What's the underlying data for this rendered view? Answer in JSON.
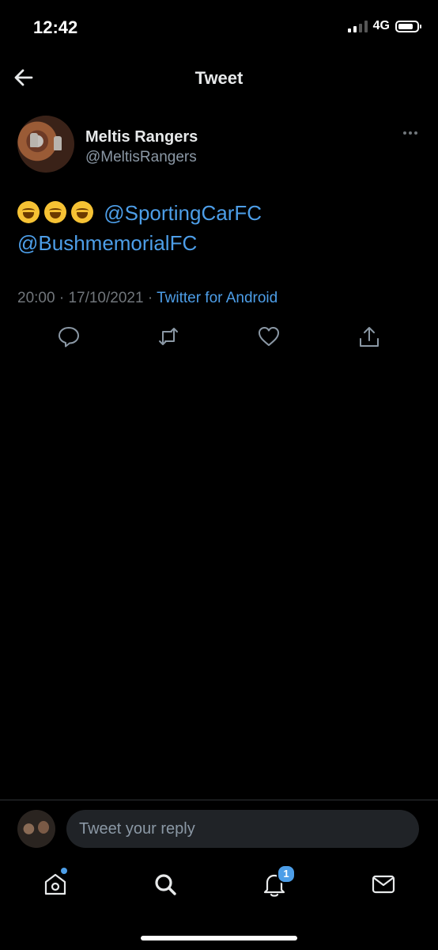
{
  "status_bar": {
    "time": "12:42",
    "network": "4G"
  },
  "nav": {
    "title": "Tweet"
  },
  "tweet": {
    "author_name": "Meltis Rangers",
    "author_handle": "@MeltisRangers",
    "emoji_count": 3,
    "mention_1": "@SportingCarFC",
    "mention_2": "@BushmemorialFC",
    "time": "20:00",
    "date": "17/10/2021",
    "separator": "·",
    "source": "Twitter for Android"
  },
  "reply": {
    "placeholder": "Tweet your reply"
  },
  "tabbar": {
    "notifications_badge": "1"
  },
  "colors": {
    "accent": "#4d9ee8",
    "background": "#000000",
    "text": "#e7e9ea",
    "muted": "#71767b"
  },
  "icons": {
    "back": "arrow-left-icon",
    "more": "more-dots-icon",
    "reply": "comment-icon",
    "retweet": "retweet-icon",
    "like": "heart-icon",
    "share": "share-icon",
    "home": "home-icon",
    "search": "search-icon",
    "notifications": "bell-icon",
    "messages": "mail-icon"
  }
}
